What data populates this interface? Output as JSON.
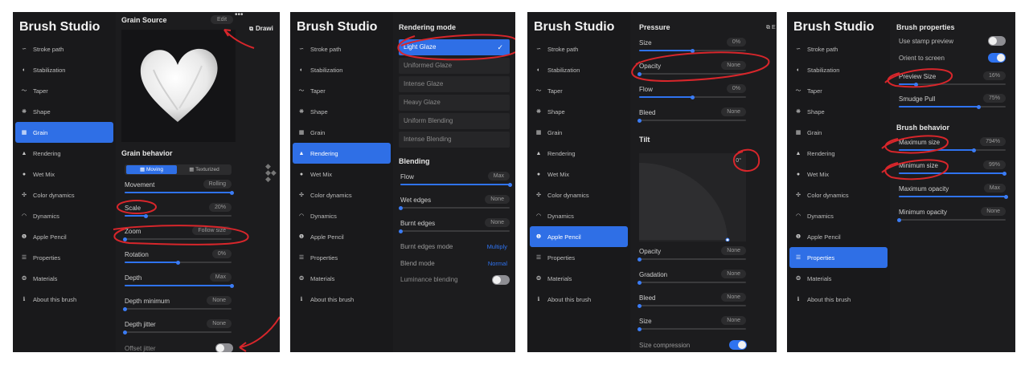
{
  "app_title": "Brush Studio",
  "nav": [
    "Stroke path",
    "Stabilization",
    "Taper",
    "Shape",
    "Grain",
    "Rendering",
    "Wet Mix",
    "Color dynamics",
    "Dynamics",
    "Apple Pencil",
    "Properties",
    "Materials",
    "About this brush"
  ],
  "nav_icons": [
    "stroke-path-icon",
    "stabilization-icon",
    "taper-icon",
    "shape-icon",
    "grain-icon",
    "rendering-icon",
    "wet-mix-icon",
    "color-dynamics-icon",
    "dynamics-icon",
    "apple-pencil-icon",
    "properties-icon",
    "materials-icon",
    "info-icon"
  ],
  "accent_color": "#2f73f0",
  "annotation_color": "#d8262b",
  "panel1": {
    "active_nav_index": 4,
    "grain_source": "Grain Source",
    "edit_button": "Edit",
    "drawing_tab": "Drawi",
    "grain_behavior": "Grain behavior",
    "mode_moving": "Moving",
    "mode_texturized": "Texturized",
    "rows": [
      {
        "label": "Movement",
        "value": "Rolling",
        "level": 1.0
      },
      {
        "label": "Scale",
        "value": "20%",
        "level": 0.2
      },
      {
        "label": "Zoom",
        "value": "Follow size",
        "level": 0.0
      },
      {
        "label": "Rotation",
        "value": "0%",
        "level": 0.5
      },
      {
        "label": "Depth",
        "value": "Max",
        "level": 1.0
      },
      {
        "label": "Depth minimum",
        "value": "None",
        "level": 0.0
      },
      {
        "label": "Depth jitter",
        "value": "None",
        "level": 0.0
      }
    ],
    "offset_jitter": "Offset jitter",
    "offset_jitter_on": false
  },
  "panel2": {
    "active_nav_index": 5,
    "rendering_mode": "Rendering mode",
    "modes": [
      "Light Glaze",
      "Uniformed Glaze",
      "Intense Glaze",
      "Heavy Glaze",
      "Uniform Blending",
      "Intense Blending"
    ],
    "selected_mode": 0,
    "blending": "Blending",
    "rows": [
      {
        "label": "Flow",
        "value": "Max",
        "level": 1.0
      },
      {
        "label": "Wet edges",
        "value": "None",
        "level": 0.0
      },
      {
        "label": "Burnt edges",
        "value": "None",
        "level": 0.0
      }
    ],
    "burnt_edges_mode": {
      "label": "Burnt edges mode",
      "value": "Multiply"
    },
    "blend_mode": {
      "label": "Blend mode",
      "value": "Normal"
    },
    "luminance_blending": "Luminance blending",
    "luminance_on": false
  },
  "panel3": {
    "active_nav_index": 9,
    "pressure": "Pressure",
    "pressure_rows": [
      {
        "label": "Size",
        "value": "0%",
        "level": 0.5
      },
      {
        "label": "Opacity",
        "value": "None",
        "level": 0.0
      },
      {
        "label": "Flow",
        "value": "0%",
        "level": 0.5
      },
      {
        "label": "Bleed",
        "value": "None",
        "level": 0.0
      }
    ],
    "tilt": "Tilt",
    "tilt_angle": "0°",
    "tilt_rows": [
      {
        "label": "Opacity",
        "value": "None",
        "level": 0.0
      },
      {
        "label": "Gradation",
        "value": "None",
        "level": 0.0
      },
      {
        "label": "Bleed",
        "value": "None",
        "level": 0.0
      },
      {
        "label": "Size",
        "value": "None",
        "level": 0.0
      }
    ],
    "size_compression": "Size compression",
    "size_compression_on": true
  },
  "panel4": {
    "active_nav_index": 10,
    "brush_properties": "Brush properties",
    "use_stamp_preview": "Use stamp preview",
    "stamp_preview_on": false,
    "orient_to_screen": "Orient to screen",
    "orient_on": true,
    "prop_rows": [
      {
        "label": "Preview Size",
        "value": "16%",
        "level": 0.16
      },
      {
        "label": "Smudge Pull",
        "value": "75%",
        "level": 0.75
      }
    ],
    "brush_behavior": "Brush behavior",
    "behavior_rows": [
      {
        "label": "Maximum size",
        "value": "794%",
        "level": 0.7
      },
      {
        "label": "Minimum size",
        "value": "99%",
        "level": 0.99
      },
      {
        "label": "Maximum opacity",
        "value": "Max",
        "level": 1.0
      },
      {
        "label": "Minimum opacity",
        "value": "None",
        "level": 0.0
      }
    ]
  }
}
